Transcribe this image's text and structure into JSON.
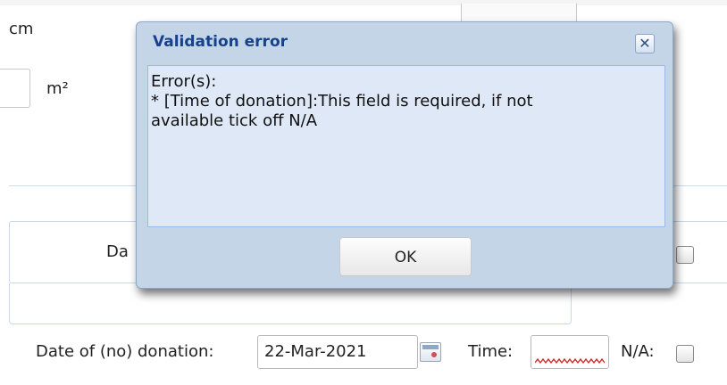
{
  "background_form": {
    "unit_cm": "cm",
    "unit_m2": "m²",
    "panel_label_partial": "Da",
    "donation_label": "Date of (no) donation:",
    "donation_date_value": "22-Mar-2021",
    "time_label": "Time:",
    "time_value": "",
    "na_label": "N/A:"
  },
  "dialog": {
    "title": "Validation error",
    "close_glyph": "✕",
    "body_lines": [
      "Error(s):",
      "* [Time of donation]:This field is required, if not",
      "available tick off N/A"
    ],
    "ok_label": "OK"
  },
  "colors": {
    "dialog_frame": "#c5d5e8",
    "dialog_title": "#15428b",
    "dialog_body_bg": "#dfe8f6",
    "dialog_body_border": "#99bbe8",
    "error_squiggle": "#d12a2a"
  },
  "icons": {
    "calendar": "calendar-icon",
    "close": "close-icon"
  }
}
